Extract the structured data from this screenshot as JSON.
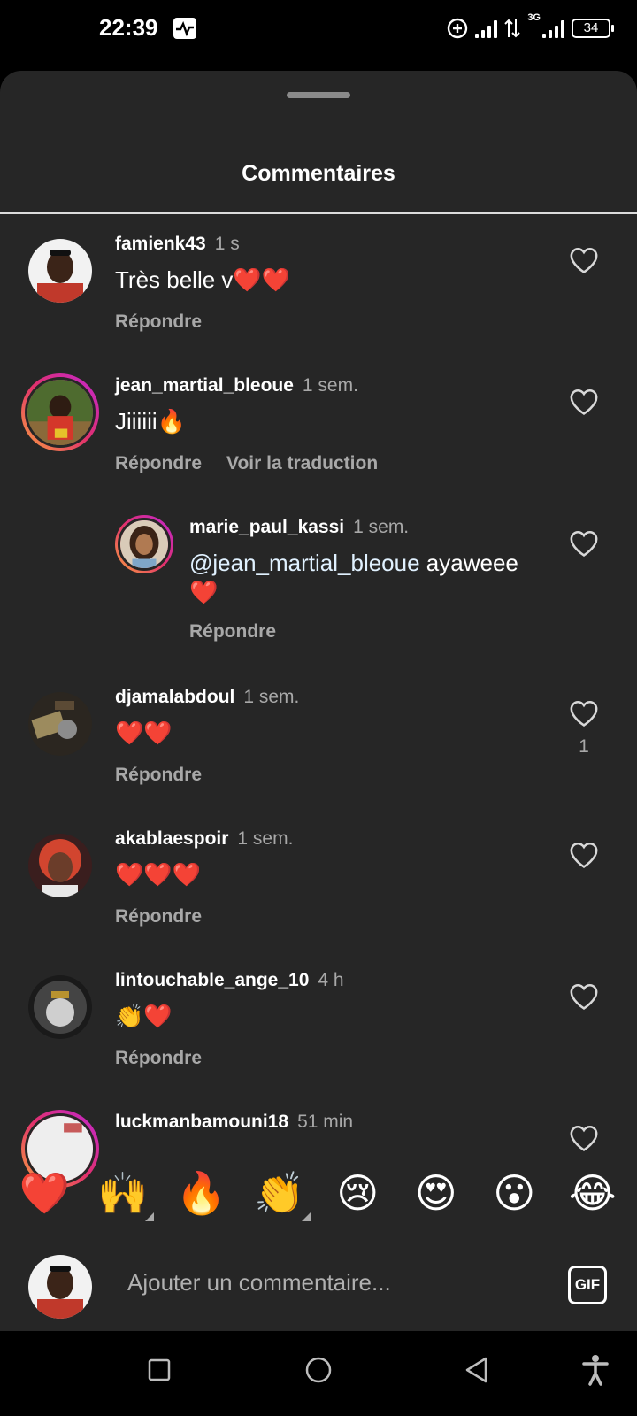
{
  "status": {
    "time": "22:39",
    "network": "3G",
    "battery": "34"
  },
  "sheet": {
    "title": "Commentaires"
  },
  "comments": [
    {
      "user": "famienk43",
      "time": "1 s",
      "text": "Très belle v❤️❤️",
      "reply": "Répondre"
    },
    {
      "user": "jean_martial_bleoue",
      "time": "1 sem.",
      "text": "Jiiiiii🔥",
      "reply": "Répondre",
      "translate": "Voir la traduction"
    },
    {
      "user": "marie_paul_kassi",
      "time": "1 sem.",
      "mention": "@jean_martial_bleoue",
      "text": " ayaweee",
      "text2": "❤️",
      "reply": "Répondre"
    },
    {
      "user": "djamalabdoul",
      "time": "1 sem.",
      "text": "❤️❤️",
      "reply": "Répondre",
      "likes": "1"
    },
    {
      "user": "akablaespoir",
      "time": "1 sem.",
      "text": "❤️❤️❤️",
      "reply": "Répondre"
    },
    {
      "user": "lintouchable_ange_10",
      "time": "4 h",
      "text": "👏❤️",
      "reply": "Répondre"
    },
    {
      "user": "luckmanbamouni18",
      "time": "51 min"
    }
  ],
  "reactions": [
    "❤️",
    "🙌",
    "🔥",
    "👏",
    "😢",
    "😍",
    "😮",
    "😂"
  ],
  "input": {
    "placeholder": "Ajouter un commentaire...",
    "gif_label": "GIF"
  },
  "colors": {
    "sheet_bg": "#262626",
    "muted_text": "#a8a8a8",
    "story_ring": "#e1306c"
  }
}
